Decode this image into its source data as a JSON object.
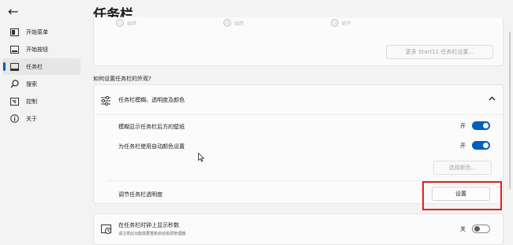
{
  "back_icon": "arrow-left-icon",
  "page_title": "任务栏",
  "sidebar": {
    "items": [
      {
        "label": "开始菜单",
        "icon": "start-menu-icon"
      },
      {
        "label": "开始按钮",
        "icon": "start-button-icon"
      },
      {
        "label": "任务栏",
        "icon": "taskbar-icon",
        "active": true
      },
      {
        "label": "搜索",
        "icon": "search-icon"
      },
      {
        "label": "控制",
        "icon": "control-icon"
      },
      {
        "label": "关于",
        "icon": "info-icon"
      }
    ]
  },
  "top_card": {
    "radios": [
      "始终",
      "始终",
      "绝不"
    ],
    "more_button": "更多 Start11 任务栏设置..."
  },
  "section_label": "如何设置任务栏的外观?",
  "appearance": {
    "header_label": "任务栏模糊、透明度及颜色",
    "blur_label": "模糊显示任务栏后方的壁纸",
    "blur_state": "开",
    "auto_color_label": "为任务栏使用自动颜色设置",
    "auto_color_state": "开",
    "choose_color_button": "选择颜色...",
    "transparency_label": "调节任务栏透明度",
    "settings_button": "设置"
  },
  "seconds": {
    "title": "在任务栏时钟上显示秒数",
    "subtitle": "请注意此功能需要重新启动资源管理器",
    "state": "关"
  },
  "colors": {
    "accent": "#005fb8",
    "highlight": "#e02020"
  }
}
